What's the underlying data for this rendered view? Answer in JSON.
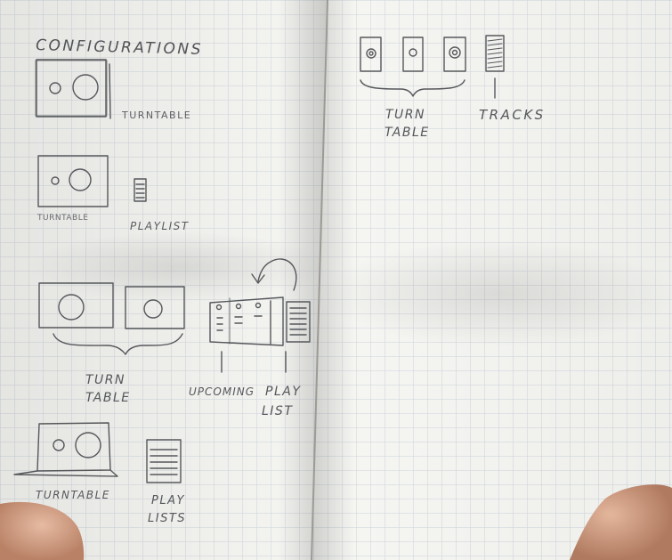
{
  "left_page": {
    "heading": "CONFIGURATIONS",
    "sketch_1": {
      "label": "TURNTABLE"
    },
    "sketch_2": {
      "label_turntable": "TURNTABLE",
      "label_playlist": "PLAYLIST"
    },
    "sketch_3": {
      "label_turntable_line1": "TURN",
      "label_turntable_line2": "TABLE",
      "label_upcoming": "UPCOMING",
      "label_playlist_line1": "PLAY",
      "label_playlist_line2": "LIST"
    },
    "sketch_4": {
      "label_turntable": "TURNTABLE",
      "label_playlists_line1": "PLAY",
      "label_playlists_line2": "LISTS"
    }
  },
  "right_page": {
    "label_turntable_line1": "TURN",
    "label_turntable_line2": "TABLE",
    "label_tracks": "TRACKS"
  },
  "colors": {
    "paper": "#f4f4f1",
    "grid": "#c9d0d6",
    "pencil": "#55575a",
    "skin": "#d8a98f"
  }
}
